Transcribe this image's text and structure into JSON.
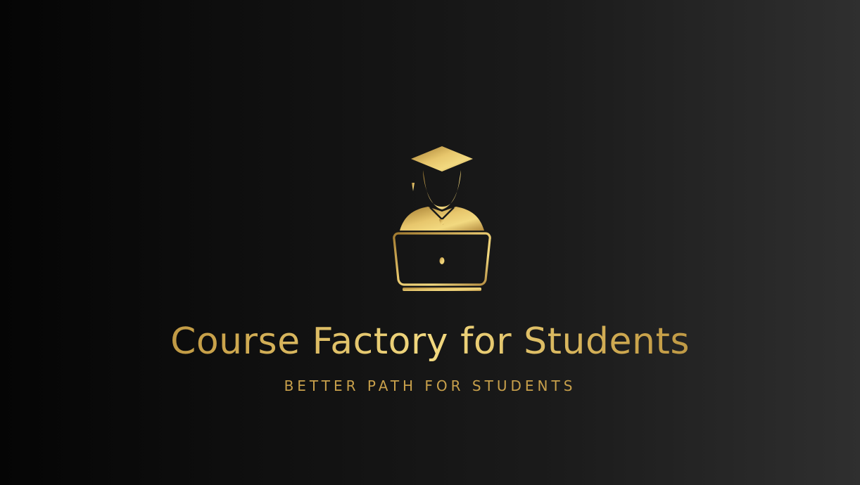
{
  "brand": {
    "title": "Course Factory for Students",
    "tagline": "BETTER PATH FOR STUDENTS"
  },
  "logo": {
    "icon": "graduate-laptop-icon",
    "color": "#d6b15e",
    "accent": "#f2d980"
  }
}
